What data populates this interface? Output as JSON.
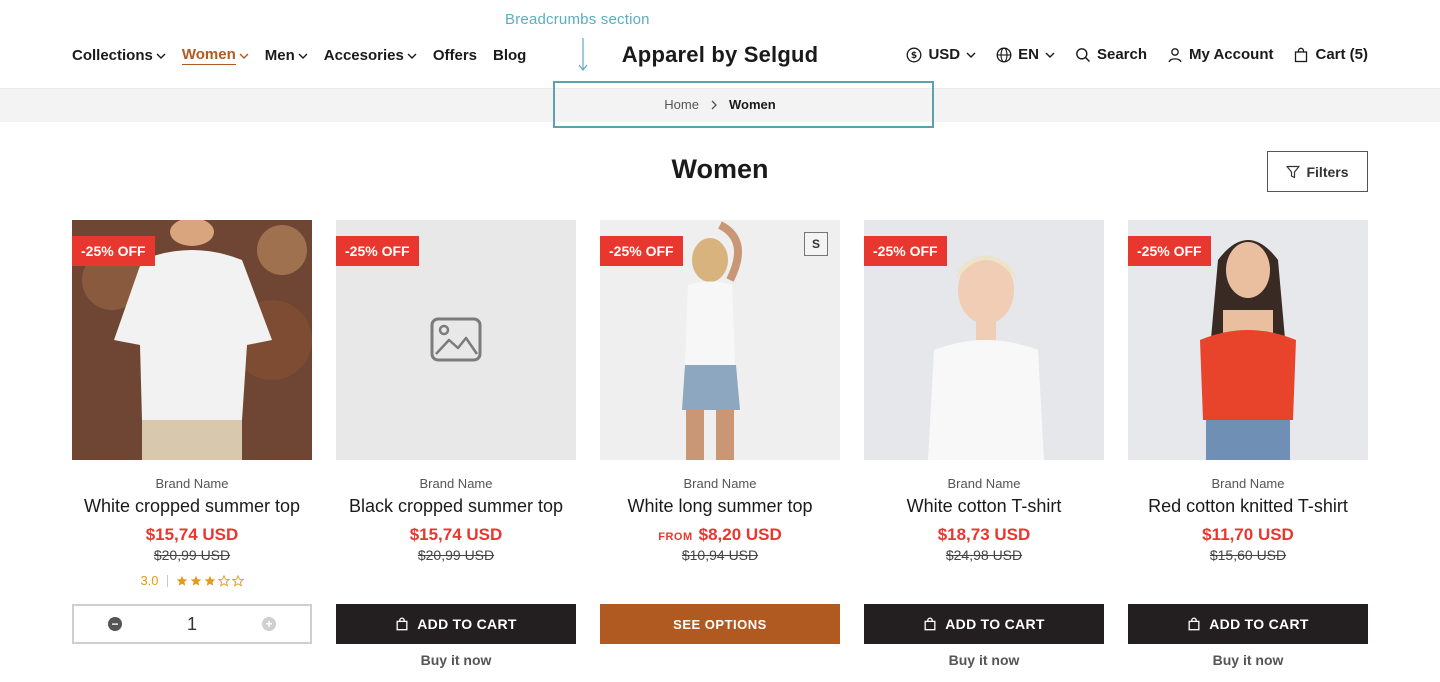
{
  "annotation": {
    "label": "Breadcrumbs section"
  },
  "header": {
    "nav": [
      {
        "label": "Collections",
        "dropdown": true,
        "active": false
      },
      {
        "label": "Women",
        "dropdown": true,
        "active": true
      },
      {
        "label": "Men",
        "dropdown": true,
        "active": false
      },
      {
        "label": "Accesories",
        "dropdown": true,
        "active": false
      },
      {
        "label": "Offers",
        "dropdown": false,
        "active": false
      },
      {
        "label": "Blog",
        "dropdown": false,
        "active": false
      }
    ],
    "logo": "Apparel by Selgud",
    "currency": "USD",
    "language": "EN",
    "search_label": "Search",
    "account_label": "My Account",
    "cart_label": "Cart (5)"
  },
  "breadcrumb": {
    "home": "Home",
    "current": "Women"
  },
  "page": {
    "title": "Women",
    "filters_label": "Filters"
  },
  "products": [
    {
      "badge": "-25% OFF",
      "brand": "Brand Name",
      "name": "White cropped summer top",
      "price": "$15,74 USD",
      "old_price": "$20,99 USD",
      "rating": "3.0",
      "stars": 3,
      "quantity": "1"
    },
    {
      "badge": "-25% OFF",
      "brand": "Brand Name",
      "name": "Black cropped summer top",
      "price": "$15,74 USD",
      "old_price": "$20,99 USD",
      "button": "ADD TO CART",
      "buy_now": "Buy it now"
    },
    {
      "badge": "-25% OFF",
      "size": "S",
      "brand": "Brand Name",
      "name": "White long summer top",
      "price_prefix": "FROM",
      "price": "$8,20 USD",
      "old_price": "$10,94 USD",
      "button": "SEE OPTIONS"
    },
    {
      "badge": "-25% OFF",
      "brand": "Brand Name",
      "name": "White cotton T-shirt",
      "price": "$18,73 USD",
      "old_price": "$24,98 USD",
      "button": "ADD TO CART",
      "buy_now": "Buy it now"
    },
    {
      "badge": "-25% OFF",
      "brand": "Brand Name",
      "name": "Red cotton knitted T-shirt",
      "price": "$11,70 USD",
      "old_price": "$15,60 USD",
      "button": "ADD TO CART",
      "buy_now": "Buy it now"
    }
  ],
  "colors": {
    "accent": "#b05a21",
    "sale": "#e8372e",
    "dark_button": "#231f20",
    "annotation": "#5aa3ad",
    "star": "#e59a1a"
  },
  "icons": [
    "chevron-down-icon",
    "dollar-circle-icon",
    "globe-icon",
    "search-icon",
    "user-icon",
    "bag-icon",
    "filter-icon",
    "image-placeholder-icon",
    "star-icon"
  ]
}
